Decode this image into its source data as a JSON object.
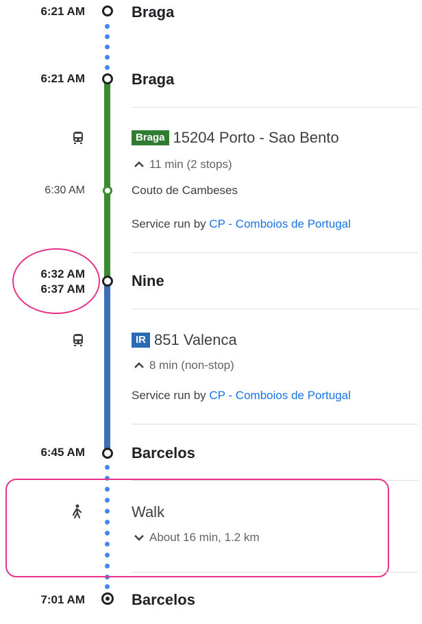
{
  "stops": [
    {
      "time": "6:21 AM",
      "name": "Braga"
    },
    {
      "time": "6:21 AM",
      "name": "Braga"
    },
    {
      "time_arrive": "6:32 AM",
      "time_depart": "6:37 AM",
      "name": "Nine"
    },
    {
      "time": "6:45 AM",
      "name": "Barcelos"
    },
    {
      "time": "7:01 AM",
      "name": "Barcelos"
    }
  ],
  "leg1": {
    "badge": "Braga",
    "route": "15204 Porto - Sao Bento",
    "duration": "11 min (2 stops)",
    "intermediate_time": "6:30 AM",
    "intermediate_stop": "Couto de Cambeses",
    "service_prefix": "Service run by ",
    "operator": "CP - Comboios de Portugal",
    "color": "#3a8a2e"
  },
  "leg2": {
    "badge": "IR",
    "route": "851 Valenca",
    "duration": "8 min (non-stop)",
    "service_prefix": "Service run by ",
    "operator": "CP - Comboios de Portugal",
    "color": "#3c6fb8"
  },
  "walk": {
    "label": "Walk",
    "detail": "About 16 min, 1.2 km"
  },
  "highlight_color": "#e8318b",
  "icons": [
    "train-icon",
    "walk-icon",
    "chevron-up-icon",
    "chevron-down-icon",
    "destination-icon"
  ]
}
